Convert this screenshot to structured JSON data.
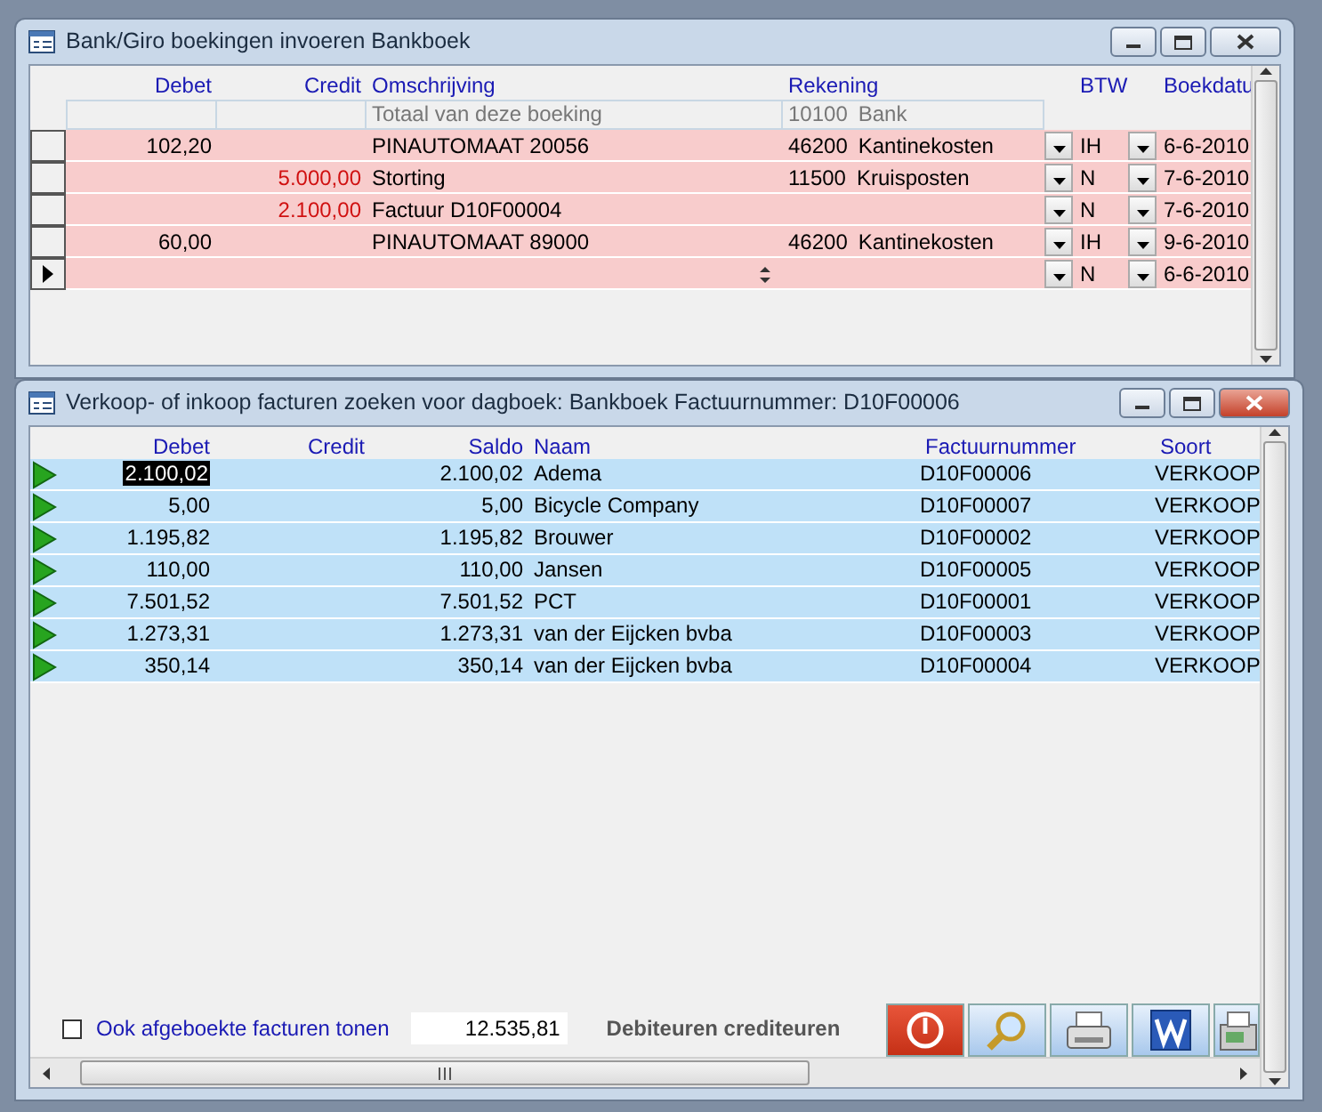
{
  "entry_window": {
    "title": "Bank/Giro boekingen invoeren Bankboek",
    "columns": [
      "Debet",
      "Credit",
      "Omschrijving",
      "Rekening",
      "BTW",
      "Boekdatu"
    ],
    "total_row": {
      "description": "Totaal van deze boeking",
      "account_number": "10100",
      "account_name": "Bank"
    },
    "rows": [
      {
        "debet": "102,20",
        "description": "PINAUTOMAAT 20056",
        "account_number": "46200",
        "account_name": "Kantinekosten",
        "btw": "IH",
        "date": "6-6-2010",
        "current": false
      },
      {
        "credit": "5.000,00",
        "description": "Storting",
        "account_number": "11500",
        "account_name": "Kruisposten",
        "btw": "N",
        "date": "7-6-2010",
        "current": false
      },
      {
        "credit": "2.100,00",
        "description": "Factuur D10F00004",
        "btw": "N",
        "date": "7-6-2010",
        "current": false
      },
      {
        "debet": "60,00",
        "description": "PINAUTOMAAT 89000",
        "account_number": "46200",
        "account_name": "Kantinekosten",
        "btw": "IH",
        "date": "9-6-2010",
        "current": false
      },
      {
        "btw": "N",
        "date": "6-6-2010",
        "current": true
      }
    ]
  },
  "search_window": {
    "title": "Verkoop- of inkoop facturen zoeken voor dagboek: Bankboek Factuurnummer: D10F00006",
    "columns": [
      "Debet",
      "Credit",
      "Saldo",
      "Naam",
      "Factuurnummer",
      "Soort"
    ],
    "rows": [
      {
        "debet": "2.100,02",
        "saldo": "2.100,02",
        "naam": "Adema",
        "factuurnummer": "D10F00006",
        "soort": "VERKOOP",
        "selected": true
      },
      {
        "debet": "5,00",
        "saldo": "5,00",
        "naam": "Bicycle Company",
        "factuurnummer": "D10F00007",
        "soort": "VERKOOP",
        "selected": false
      },
      {
        "debet": "1.195,82",
        "saldo": "1.195,82",
        "naam": "Brouwer",
        "factuurnummer": "D10F00002",
        "soort": "VERKOOP",
        "selected": false
      },
      {
        "debet": "110,00",
        "saldo": "110,00",
        "naam": "Jansen",
        "factuurnummer": "D10F00005",
        "soort": "VERKOOP",
        "selected": false
      },
      {
        "debet": "7.501,52",
        "saldo": "7.501,52",
        "naam": "PCT",
        "factuurnummer": "D10F00001",
        "soort": "VERKOOP",
        "selected": false
      },
      {
        "debet": "1.273,31",
        "saldo": "1.273,31",
        "naam": "van der Eijcken bvba",
        "factuurnummer": "D10F00003",
        "soort": "VERKOOP",
        "selected": false
      },
      {
        "debet": "350,14",
        "saldo": "350,14",
        "naam": "van der Eijcken bvba",
        "factuurnummer": "D10F00004",
        "soort": "VERKOOP",
        "selected": false
      }
    ],
    "footer": {
      "checkbox": {
        "label": "Ook afgeboekte facturen tonen",
        "checked": false
      },
      "total": "12.535,81",
      "label": "Debiteuren crediteuren"
    }
  }
}
